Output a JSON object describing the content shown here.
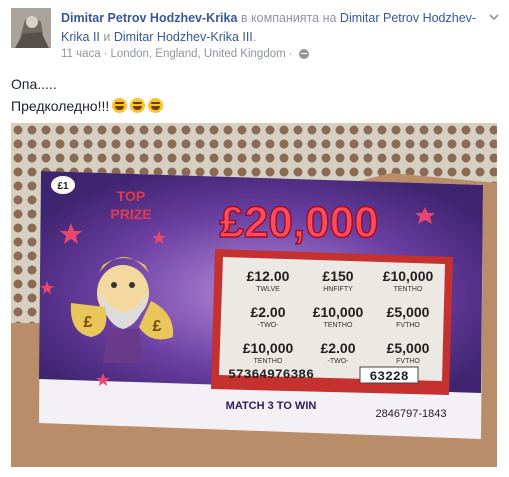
{
  "post": {
    "author": "Dimitar Petrov Hodzhev-Krika",
    "with_text": "в компанията на",
    "tagged_1": "Dimitar Petrov Hodzhev-Krika II",
    "and_text": "и",
    "tagged_2": "Dimitar Hodzhev-Krika III",
    "end_punct": ".",
    "time": "11 часа",
    "location": "London, England, United Kingdom",
    "text_line_1": "Опа.....",
    "text_line_2": "Предколедно!!!",
    "emoji_count": 3,
    "emoji_name": "laughing-tears-emoji"
  },
  "ticket": {
    "price_badge": "£1",
    "top_label_1": "TOP",
    "top_label_2": "PRIZE",
    "top_prize": "£20,000",
    "grid": [
      {
        "amount": "£12.00",
        "word": "TWLVE"
      },
      {
        "amount": "£150",
        "word": "HNFIFTY"
      },
      {
        "amount": "£10,000",
        "word": "TENTHO"
      },
      {
        "amount": "£2.00",
        "word": "-TWO-"
      },
      {
        "amount": "£10,000",
        "word": "TENTHO"
      },
      {
        "amount": "£5,000",
        "word": "FVTHO"
      },
      {
        "amount": "£10,000",
        "word": "TENTHO"
      },
      {
        "amount": "£2.00",
        "word": "-TWO-"
      },
      {
        "amount": "£5,000",
        "word": "FVTHO"
      }
    ],
    "serial_left": "57364976386",
    "serial_right": "63228",
    "match_text": "MATCH 3 TO WIN",
    "ticket_number": "2846797-1843"
  },
  "colors": {
    "link": "#365899",
    "meta": "#90949c",
    "ticket_purple": "#4b2a7a",
    "prize_red": "#e23a4e"
  }
}
